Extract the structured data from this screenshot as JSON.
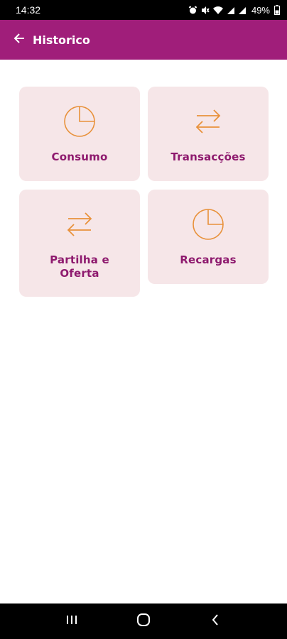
{
  "status_bar": {
    "time": "14:32",
    "battery": "49%",
    "icons": [
      "alarm-icon",
      "mute-icon",
      "wifi-icon",
      "signal-icon",
      "signal-icon",
      "battery-icon"
    ]
  },
  "app_bar": {
    "title": "Historico",
    "back_icon": "arrow-left-icon",
    "background": "#a01e7a"
  },
  "menu": {
    "items": [
      {
        "label": "Consumo",
        "icon": "pie-chart-icon"
      },
      {
        "label": "Transacções",
        "icon": "swap-arrows-icon"
      },
      {
        "label": "Partilha e Oferta",
        "icon": "swap-arrows-icon"
      },
      {
        "label": "Recargas",
        "icon": "pie-chart-icon"
      }
    ],
    "card_color": "#f6e6e8",
    "label_color": "#8e1a6e",
    "icon_color": "#e8913a"
  },
  "nav_bar": {
    "icons": [
      "recent-apps-icon",
      "home-icon",
      "back-icon"
    ]
  }
}
